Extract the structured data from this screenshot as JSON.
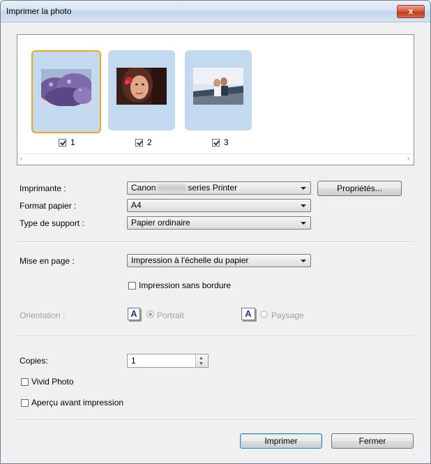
{
  "window": {
    "title": "Imprimer la photo",
    "close_glyph": "x"
  },
  "thumbnails": [
    {
      "number": "1",
      "checked": true,
      "selected": true,
      "icon": "photo-purple-tree"
    },
    {
      "number": "2",
      "checked": true,
      "selected": false,
      "icon": "photo-woman-portrait"
    },
    {
      "number": "3",
      "checked": true,
      "selected": false,
      "icon": "photo-couple-outdoors"
    }
  ],
  "scrollbar": {
    "left_arrow": "‹",
    "right_arrow": "›"
  },
  "printer": {
    "label": "Imprimante :",
    "value_prefix": "Canon",
    "value_suffix": "series Printer",
    "properties_button": "Propriétés..."
  },
  "paper_size": {
    "label": "Format papier :",
    "value": "A4"
  },
  "media_type": {
    "label": "Type de support :",
    "value": "Papier ordinaire"
  },
  "layout": {
    "label": "Mise en page :",
    "value": "Impression à l'échelle du papier"
  },
  "borderless": {
    "label": "Impression sans bordure",
    "checked": false
  },
  "orientation": {
    "label": "Orientation :",
    "icon_letter": "A",
    "portrait_label": "Portrait",
    "landscape_label": "Paysage",
    "selected": "portrait",
    "enabled": false
  },
  "copies": {
    "label": "Copies:",
    "value": "1"
  },
  "vivid_photo": {
    "label": "Vivid Photo",
    "checked": false
  },
  "preview": {
    "label": "Aperçu avant impression",
    "checked": false
  },
  "buttons": {
    "print": "Imprimer",
    "close": "Fermer"
  },
  "colors": {
    "selection": "#f3a51b",
    "thumb_bg": "#c3d9f0",
    "default_button": "#3c7fb1"
  }
}
